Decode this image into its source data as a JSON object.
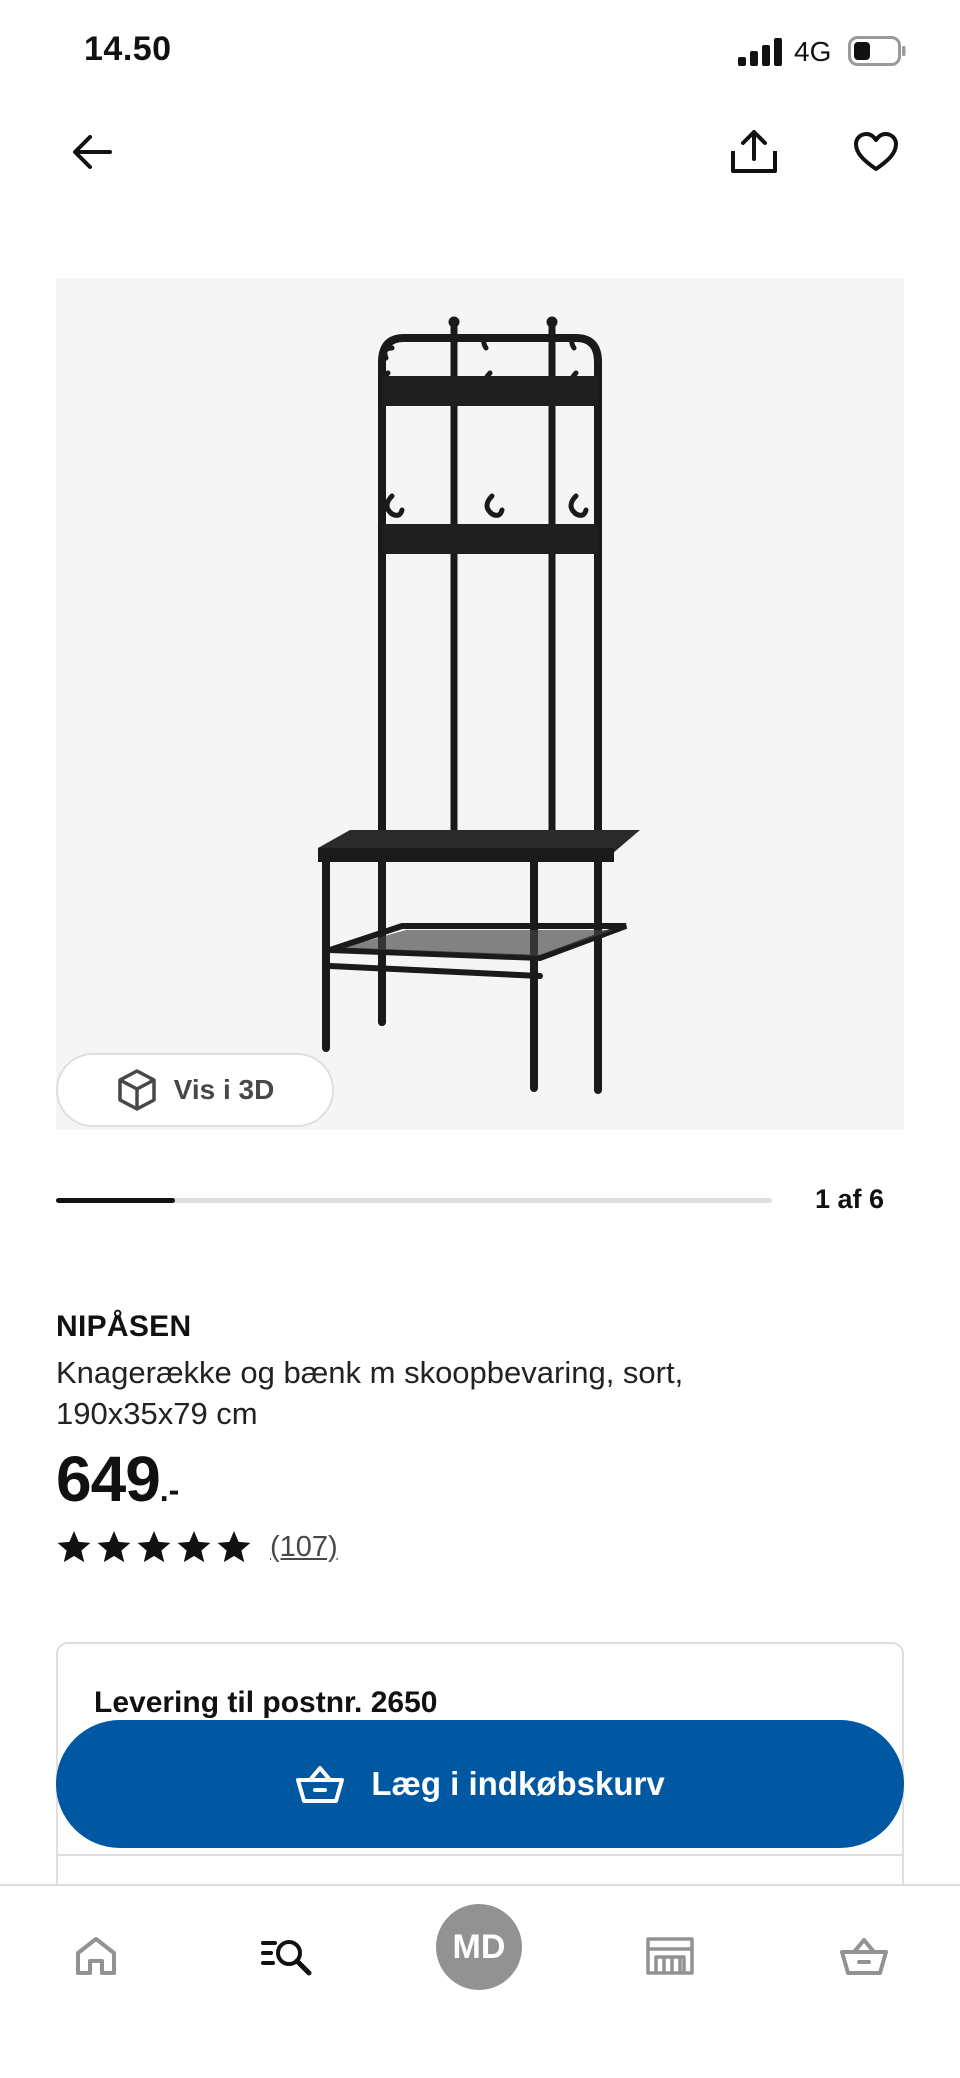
{
  "status_bar": {
    "time": "14.50",
    "network": "4G",
    "signal_icon": "signal-bars-icon",
    "battery_icon": "battery-low-icon"
  },
  "header": {
    "back_icon": "arrow-left-icon",
    "share_icon": "share-icon",
    "favorite_icon": "heart-icon"
  },
  "gallery": {
    "image_alt": "NIPÅSEN coat rack with bench",
    "view_3d_label": "Vis i 3D",
    "view_3d_icon": "cube-icon",
    "current_index": 1,
    "total": 6,
    "counter_text": "1 af 6",
    "progress_fraction": 0.1667
  },
  "product": {
    "name": "NIPÅSEN",
    "description": "Knagerække og bænk m skoopbevaring, sort, 190x35x79 cm",
    "price_integer": "649",
    "price_suffix": ".-",
    "rating_stars": 5,
    "rating_max": 5,
    "review_count": "(107)"
  },
  "delivery": {
    "title": "Levering til postnr. 2650"
  },
  "cart": {
    "label": "Læg i indkøbskurv",
    "icon": "shopping-basket-icon",
    "color": "#0058a3"
  },
  "bottom_nav": {
    "items": [
      {
        "name": "home",
        "icon": "home-icon"
      },
      {
        "name": "search",
        "icon": "search-list-icon"
      },
      {
        "name": "profile",
        "label": "MD"
      },
      {
        "name": "stores",
        "icon": "store-icon"
      },
      {
        "name": "basket",
        "icon": "shopping-basket-icon"
      }
    ]
  }
}
